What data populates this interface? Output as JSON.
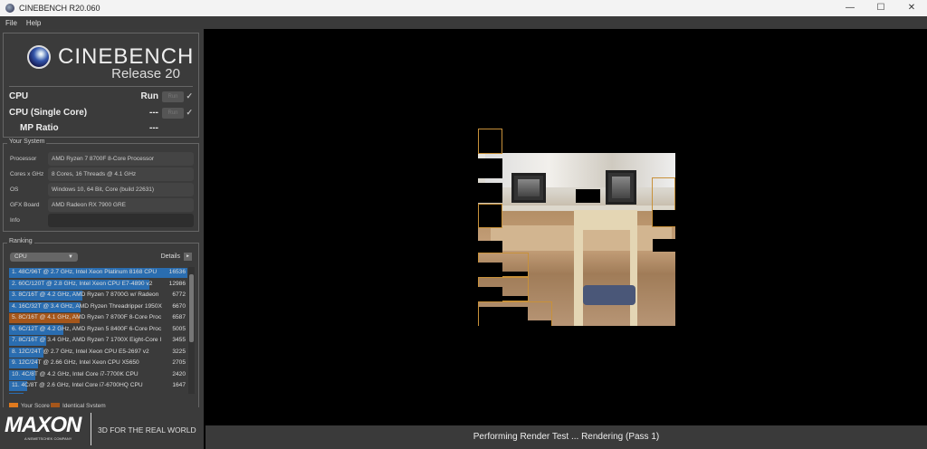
{
  "window": {
    "title": "CINEBENCH R20.060",
    "minimize": "—",
    "maximize": "☐",
    "close": "✕"
  },
  "menu": [
    "File",
    "Help"
  ],
  "header": {
    "brand": "CINEBENCH",
    "release": "Release 20"
  },
  "tests": [
    {
      "label": "CPU",
      "value": "Run",
      "button": "Run",
      "check": "✓"
    },
    {
      "label": "CPU (Single Core)",
      "value": "---",
      "button": "Run",
      "check": "✓"
    },
    {
      "label": "MP Ratio",
      "value": "---"
    }
  ],
  "system": {
    "legend": "Your System",
    "rows": [
      {
        "key": "Processor",
        "value": "AMD Ryzen 7 8700F 8-Core Processor"
      },
      {
        "key": "Cores x GHz",
        "value": "8 Cores, 16 Threads @ 4.1 GHz"
      },
      {
        "key": "OS",
        "value": "Windows 10, 64 Bit, Core (build 22631)"
      },
      {
        "key": "GFX Board",
        "value": "AMD Radeon RX 7900 GRE"
      },
      {
        "key": "Info",
        "value": ""
      }
    ]
  },
  "ranking": {
    "legend": "Ranking",
    "dropdown": "CPU",
    "details": "Details",
    "details_icon": "▸",
    "items": [
      {
        "name": "1. 48C/96T @ 2.7 GHz, Intel Xeon Platinum 8168 CPU",
        "score": "16536",
        "fraction": 1.0,
        "type": "other"
      },
      {
        "name": "2. 60C/120T @ 2.8 GHz, Intel Xeon CPU E7-4890 v2",
        "score": "12986",
        "fraction": 0.785,
        "type": "other"
      },
      {
        "name": "3. 8C/16T @ 4.2 GHz, AMD Ryzen 7 8700G w/ Radeon",
        "score": "6772",
        "fraction": 0.41,
        "type": "other"
      },
      {
        "name": "4. 16C/32T @ 3.4 GHz, AMD Ryzen Threadripper 1950X",
        "score": "6670",
        "fraction": 0.403,
        "type": "other"
      },
      {
        "name": "5. 8C/16T @ 4.1 GHz, AMD Ryzen 7 8700F 8-Core Proc",
        "score": "6587",
        "fraction": 0.398,
        "type": "identical"
      },
      {
        "name": "6. 6C/12T @ 4.2 GHz, AMD Ryzen 5 8400F 6-Core Proc",
        "score": "5005",
        "fraction": 0.303,
        "type": "other"
      },
      {
        "name": "7. 8C/16T @ 3.4 GHz, AMD Ryzen 7 1700X Eight-Core I",
        "score": "3455",
        "fraction": 0.209,
        "type": "other"
      },
      {
        "name": "8. 12C/24T @ 2.7 GHz, Intel Xeon CPU E5-2697 v2",
        "score": "3225",
        "fraction": 0.195,
        "type": "other"
      },
      {
        "name": "9. 12C/24T @ 2.66 GHz, Intel Xeon CPU X5650",
        "score": "2705",
        "fraction": 0.164,
        "type": "other"
      },
      {
        "name": "10. 4C/8T @ 4.2 GHz, Intel Core i7-7700K CPU",
        "score": "2420",
        "fraction": 0.146,
        "type": "other"
      },
      {
        "name": "11. 4C/8T @ 2.6 GHz, Intel Core i7-6700HQ CPU",
        "score": "1647",
        "fraction": 0.1,
        "type": "other"
      },
      {
        "name": "",
        "score": "",
        "fraction": 0.08,
        "type": "other"
      }
    ],
    "legend_items": [
      {
        "label": "Your Score",
        "color": "#e07a1e"
      },
      {
        "label": "Identical System",
        "color": "#a5561a"
      }
    ]
  },
  "footer": {
    "brand": "MAXON",
    "subbrand": "A NEMETSCHEK COMPANY",
    "tagline": "3D FOR THE REAL WORLD"
  },
  "status": "Performing Render Test ... Rendering (Pass 1)",
  "colors": {
    "bar": "#2a6db0",
    "identical": "#a5561a",
    "your_score": "#e07a1e",
    "tile_border": "#c8913a"
  }
}
